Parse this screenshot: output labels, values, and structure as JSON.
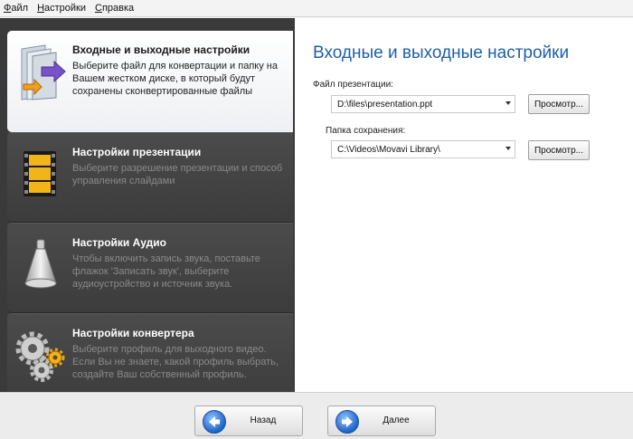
{
  "menu": [
    {
      "label": "Файл",
      "accel": "Ф"
    },
    {
      "label": "Настройки",
      "accel": "Н"
    },
    {
      "label": "Справка",
      "accel": "С"
    }
  ],
  "nav": {
    "items": [
      {
        "title": "Входные и выходные настройки",
        "desc": "Выберите файл для конвертации и папку на Вашем жестком диске, в который будут сохранены сконвертированные файлы",
        "icon": "folder-arrows-icon",
        "active": true
      },
      {
        "title": "Настройки презентации",
        "desc": "Выберите разрешение презентации и способ управления слайдами",
        "icon": "film-strip-icon",
        "active": false
      },
      {
        "title": "Настройки Аудио",
        "desc": "Чтобы включить запись звука, поставьте флажок 'Записать звук', выберите аудиоустройство и источник звука.",
        "icon": "megaphone-icon",
        "active": false
      },
      {
        "title": "Настройки конвертера",
        "desc": "Выберите профиль для выходного видео. Если Вы не знаете, какой профиль выбрать, создайте Ваш собственный профиль.",
        "icon": "gears-icon",
        "active": false
      }
    ]
  },
  "panel": {
    "title": "Входные и выходные настройки",
    "presentation_file": {
      "label": "Файл презентации:",
      "value": "D:\\files\\presentation.ppt",
      "browse": "Просмотр..."
    },
    "save_folder": {
      "label": "Папка сохранения:",
      "value": "C:\\Videos\\Movavi Library\\",
      "browse": "Просмотр..."
    }
  },
  "footer": {
    "back": "Назад",
    "next": "Далее"
  },
  "colors": {
    "accent_title": "#1d5fa8",
    "nav_bg": "#3a3a3a",
    "nav_button": "#1f63c7"
  }
}
